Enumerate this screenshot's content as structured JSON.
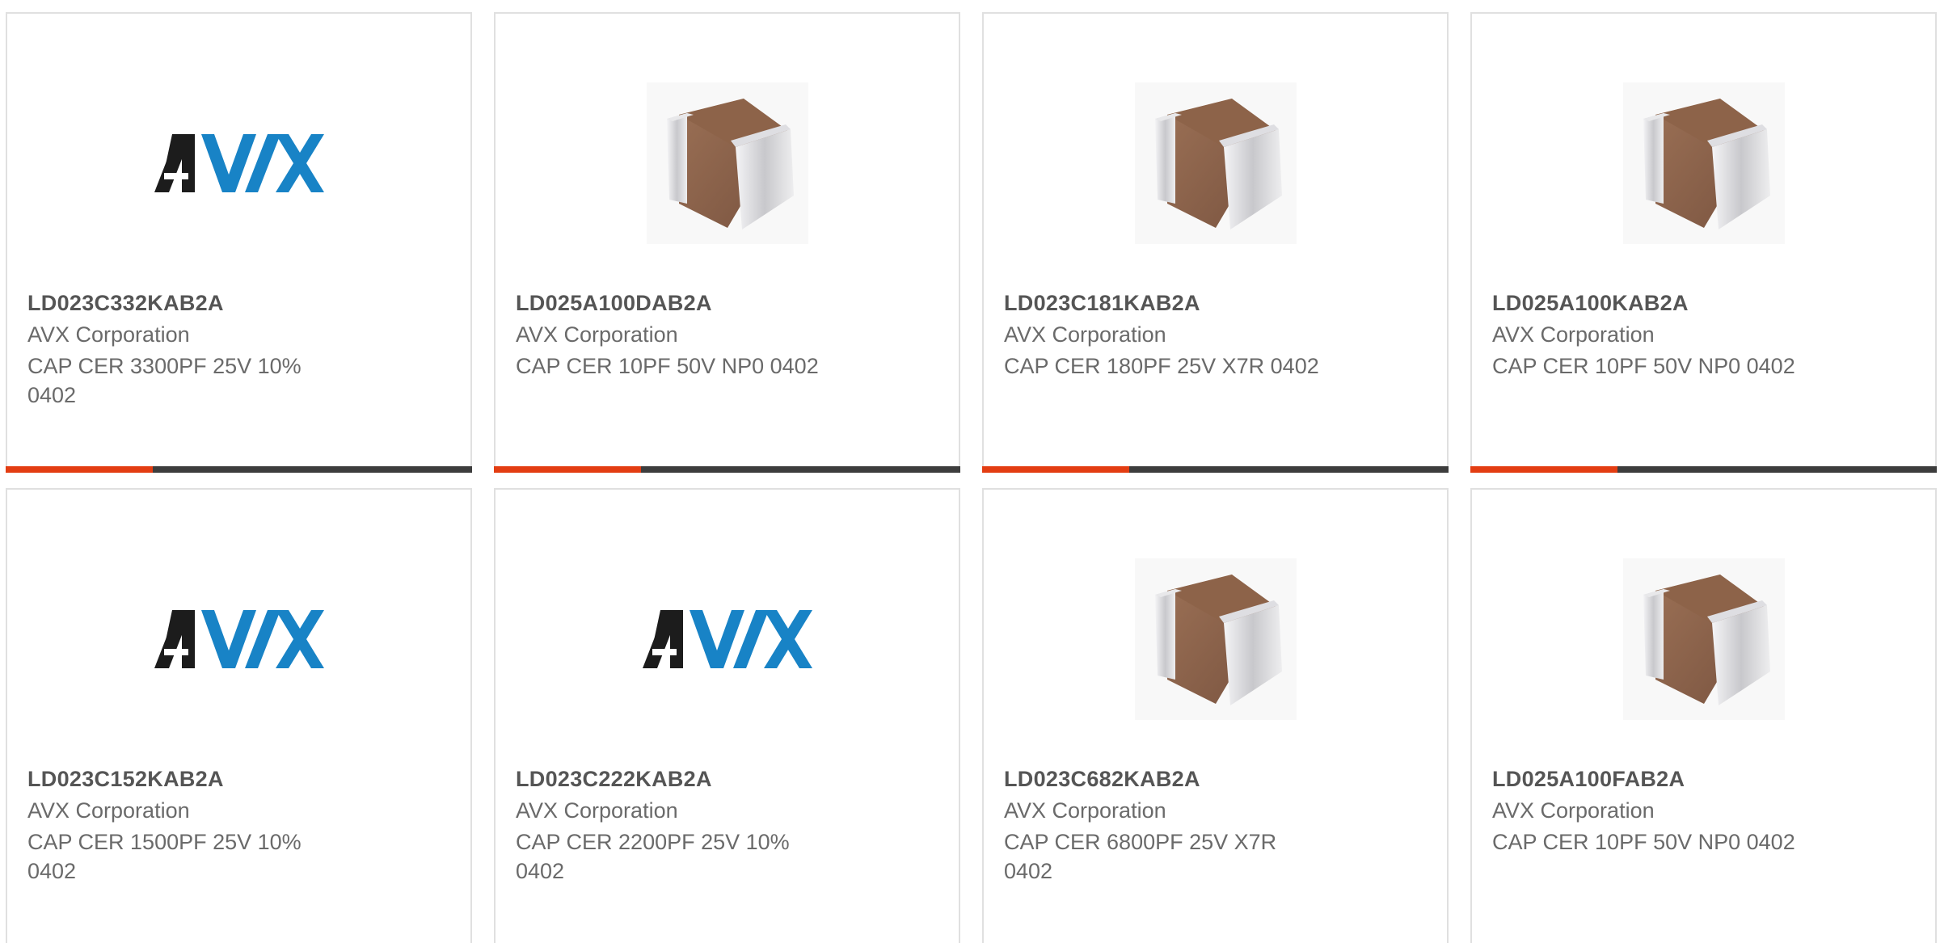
{
  "colors": {
    "accent": "#e33d12",
    "bar_dark": "#3d3d3d",
    "avx_black": "#1c1c1c",
    "avx_blue": "#1883c6",
    "chip_body": "#8a6248",
    "chip_terminal": "#d8d8dc"
  },
  "products": [
    {
      "part": "LD023C332KAB2A",
      "manufacturer": "AVX Corporation",
      "description": "CAP CER 3300PF 25V 10% 0402",
      "image": "avx-logo"
    },
    {
      "part": "LD025A100DAB2A",
      "manufacturer": "AVX Corporation",
      "description": "CAP CER 10PF 50V NP0 0402",
      "image": "capacitor-chip"
    },
    {
      "part": "LD023C181KAB2A",
      "manufacturer": "AVX Corporation",
      "description": "CAP CER 180PF 25V X7R 0402",
      "image": "capacitor-chip"
    },
    {
      "part": "LD025A100KAB2A",
      "manufacturer": "AVX Corporation",
      "description": "CAP CER 10PF 50V NP0 0402",
      "image": "capacitor-chip"
    },
    {
      "part": "LD023C152KAB2A",
      "manufacturer": "AVX Corporation",
      "description": "CAP CER 1500PF 25V 10% 0402",
      "image": "avx-logo"
    },
    {
      "part": "LD023C222KAB2A",
      "manufacturer": "AVX Corporation",
      "description": "CAP CER 2200PF 25V 10% 0402",
      "image": "avx-logo"
    },
    {
      "part": "LD023C682KAB2A",
      "manufacturer": "AVX Corporation",
      "description": "CAP CER 6800PF 25V X7R 0402",
      "image": "capacitor-chip"
    },
    {
      "part": "LD025A100FAB2A",
      "manufacturer": "AVX Corporation",
      "description": "CAP CER 10PF 50V NP0 0402",
      "image": "capacitor-chip"
    }
  ]
}
